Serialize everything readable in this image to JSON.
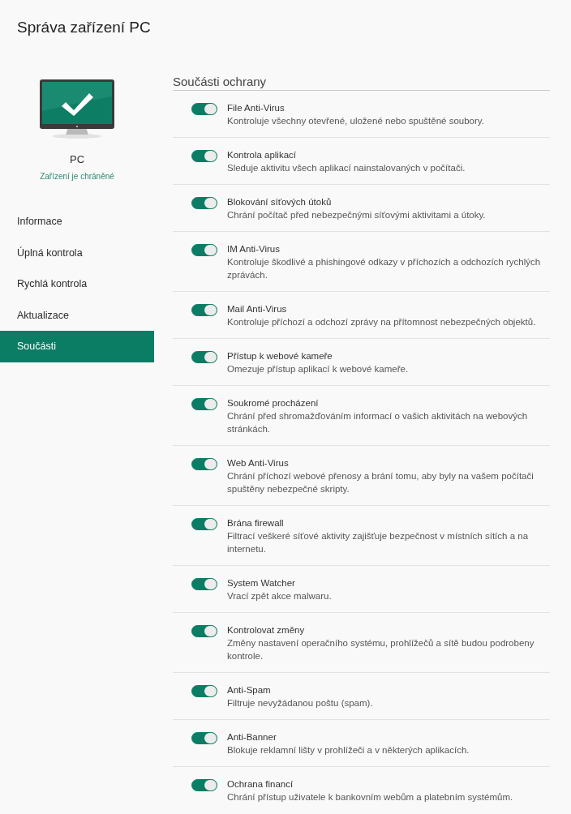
{
  "window": {
    "title": "Správa zařízení PC"
  },
  "device": {
    "name": "PC",
    "status": "Zařízení je chráněné"
  },
  "sidebar": {
    "items": [
      {
        "label": "Informace",
        "selected": false
      },
      {
        "label": "Úplná kontrola",
        "selected": false
      },
      {
        "label": "Rychlá kontrola",
        "selected": false
      },
      {
        "label": "Aktualizace",
        "selected": false
      },
      {
        "label": "Součásti",
        "selected": true
      }
    ]
  },
  "section": {
    "title": "Součásti ochrany",
    "components": [
      {
        "name": "File Anti-Virus",
        "description": "Kontroluje všechny otevřené, uložené nebo spuštěné soubory.",
        "on": true
      },
      {
        "name": "Kontrola aplikací",
        "description": "Sleduje aktivitu všech aplikací nainstalovaných v počítači.",
        "on": true
      },
      {
        "name": "Blokování síťových útoků",
        "description": "Chrání počítač před nebezpečnými síťovými aktivitami a útoky.",
        "on": true
      },
      {
        "name": "IM Anti-Virus",
        "description": "Kontroluje škodlivé a phishingové odkazy v příchozích a odchozích rychlých zprávách.",
        "on": true
      },
      {
        "name": "Mail Anti-Virus",
        "description": "Kontroluje příchozí a odchozí zprávy na přítomnost nebezpečných objektů.",
        "on": true
      },
      {
        "name": "Přístup k webové kameře",
        "description": "Omezuje přístup aplikací k webové kameře.",
        "on": true
      },
      {
        "name": "Soukromé procházení",
        "description": "Chrání před shromažďováním informací o vašich aktivitách na webových stránkách.",
        "on": true
      },
      {
        "name": "Web Anti-Virus",
        "description": "Chrání příchozí webové přenosy a brání tomu, aby byly na vašem počítači spuštěny nebezpečné skripty.",
        "on": true
      },
      {
        "name": "Brána firewall",
        "description": "Filtrací veškeré síťové aktivity zajišťuje bezpečnost v místních sítích a na internetu.",
        "on": true
      },
      {
        "name": "System Watcher",
        "description": "Vrací zpět akce malwaru.",
        "on": true
      },
      {
        "name": "Kontrolovat změny",
        "description": "Změny nastavení operačního systému, prohlížečů a sítě budou podrobeny kontrole.",
        "on": true
      },
      {
        "name": "Anti-Spam",
        "description": "Filtruje nevyžádanou poštu (spam).",
        "on": true
      },
      {
        "name": "Anti-Banner",
        "description": "Blokuje reklamní lišty v prohlížeči a v některých aplikacích.",
        "on": true
      },
      {
        "name": "Ochrana financí",
        "description": "Chrání přístup uživatele k bankovním webům a platebním systémům.",
        "on": true
      }
    ]
  }
}
